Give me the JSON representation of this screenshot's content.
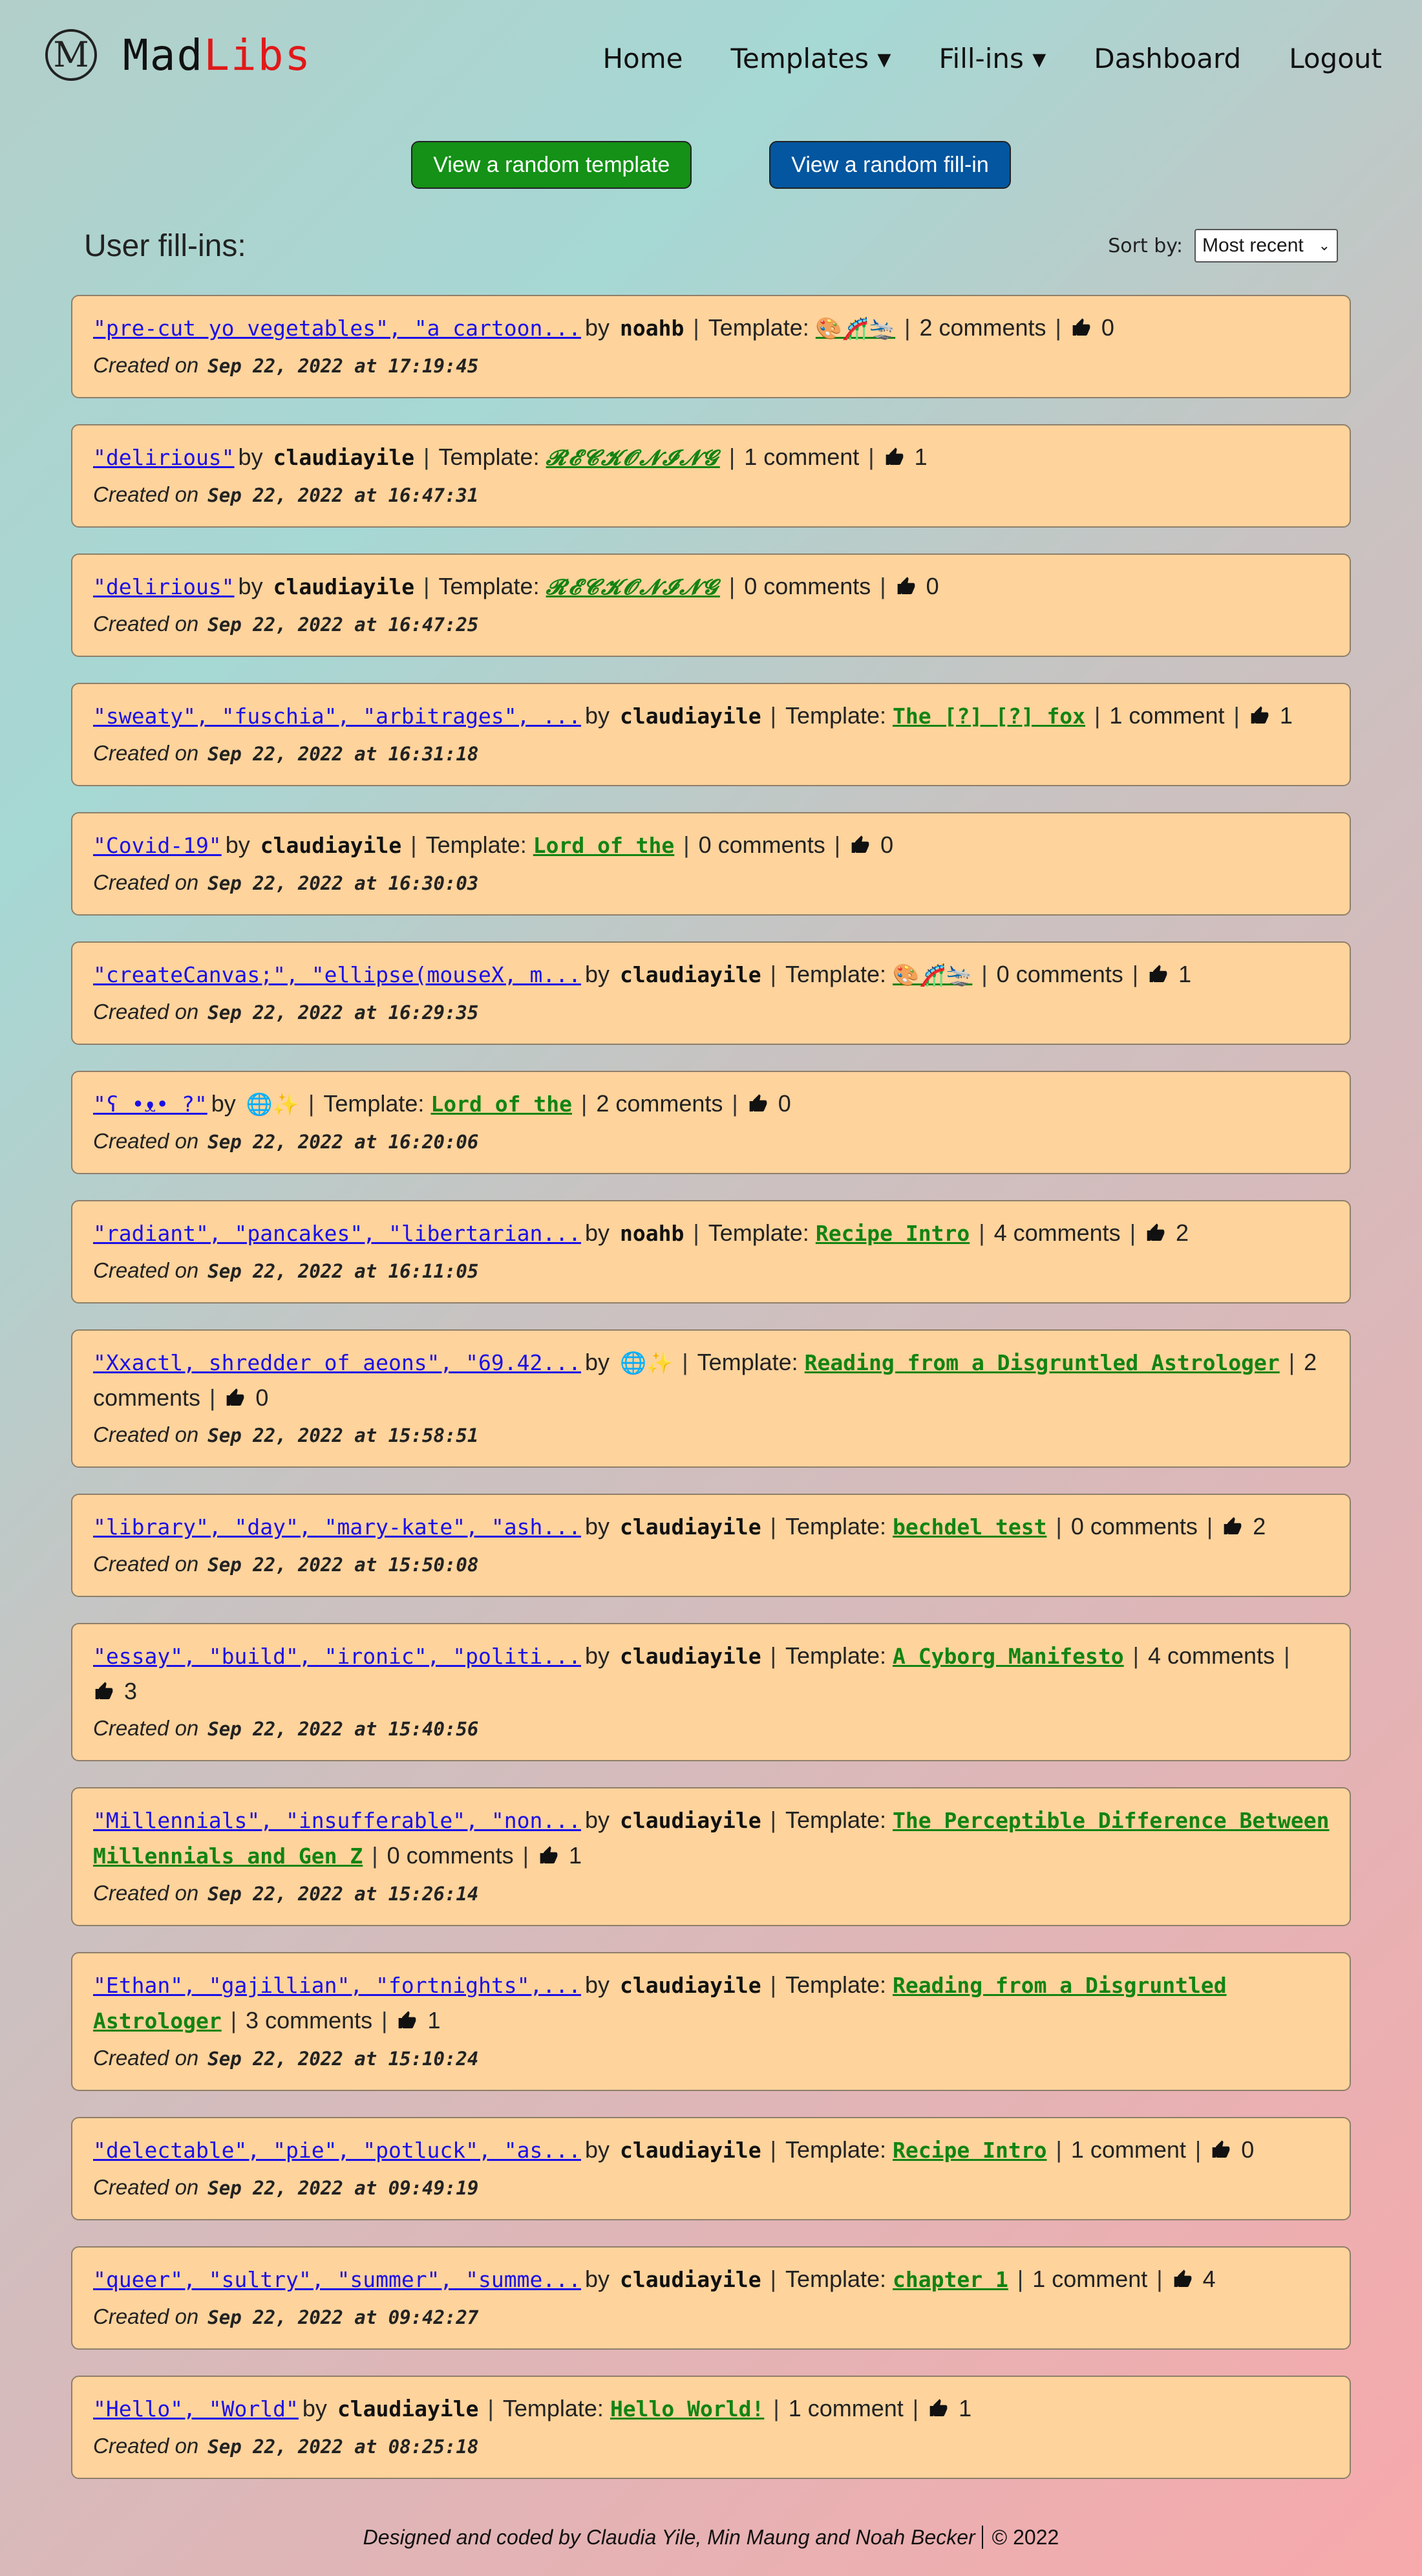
{
  "header": {
    "logo_letter": "M",
    "logo_mad": "Mad",
    "logo_libs": "Libs",
    "nav": [
      "Home",
      "Templates ▾",
      "Fill-ins ▾",
      "Dashboard",
      "Logout"
    ]
  },
  "buttons": {
    "random_template": "View a random template",
    "random_fillin": "View a random fill-in"
  },
  "page": {
    "title": "User fill-ins:",
    "sort_label": "Sort by:",
    "sort_value": "Most recent"
  },
  "labels": {
    "by": "by",
    "template": "Template:",
    "created_on": "Created on"
  },
  "fillins": [
    {
      "text": "\"pre-cut yo vegetables\", \"a cartoon...",
      "author": "noahb",
      "template": "🎨🎢🛬",
      "fancy": false,
      "comments": "2 comments",
      "likes": "0",
      "created": "Sep 22, 2022 at 17:19:45"
    },
    {
      "text": "\"delirious\"",
      "author": "claudiayile",
      "template": "𝓡𝓔𝓒𝓚𝓞𝓝𝓘𝓝𝓖",
      "fancy": true,
      "comments": "1 comment",
      "likes": "1",
      "created": "Sep 22, 2022 at 16:47:31"
    },
    {
      "text": "\"delirious\"",
      "author": "claudiayile",
      "template": "𝓡𝓔𝓒𝓚𝓞𝓝𝓘𝓝𝓖",
      "fancy": true,
      "comments": "0 comments",
      "likes": "0",
      "created": "Sep 22, 2022 at 16:47:25"
    },
    {
      "text": "\"sweaty\", \"fuschia\", \"arbitrages\", ...",
      "author": "claudiayile",
      "template": "The [?] [?] fox",
      "fancy": false,
      "comments": "1 comment",
      "likes": "1",
      "created": "Sep 22, 2022 at 16:31:18"
    },
    {
      "text": "\"Covid-19\"",
      "author": "claudiayile",
      "template": "Lord of the",
      "fancy": false,
      "comments": "0 comments",
      "likes": "0",
      "created": "Sep 22, 2022 at 16:30:03"
    },
    {
      "text": "\"createCanvas;\", \"ellipse(mouseX, m...",
      "author": "claudiayile",
      "template": "🎨🎢🛬",
      "fancy": false,
      "comments": "0 comments",
      "likes": "1",
      "created": "Sep 22, 2022 at 16:29:35"
    },
    {
      "text": "\"ʕ •ᴥ• ?\"",
      "author": "🌐✨",
      "template": "Lord of the",
      "fancy": false,
      "comments": "2 comments",
      "likes": "0",
      "created": "Sep 22, 2022 at 16:20:06"
    },
    {
      "text": "\"radiant\", \"pancakes\", \"libertarian...",
      "author": "noahb",
      "template": "Recipe Intro",
      "fancy": false,
      "comments": "4 comments",
      "likes": "2",
      "created": "Sep 22, 2022 at 16:11:05"
    },
    {
      "text": "\"Xxactl, shredder of aeons\", \"69.42...",
      "author": "🌐✨",
      "template": "Reading from a Disgruntled Astrologer",
      "fancy": false,
      "comments": "2 comments",
      "likes": "0",
      "created": "Sep 22, 2022 at 15:58:51"
    },
    {
      "text": "\"library\", \"day\", \"mary-kate\", \"ash...",
      "author": "claudiayile",
      "template": "bechdel test",
      "fancy": false,
      "comments": "0 comments",
      "likes": "2",
      "created": "Sep 22, 2022 at 15:50:08"
    },
    {
      "text": "\"essay\", \"build\", \"ironic\", \"politi...",
      "author": "claudiayile",
      "template": "A Cyborg Manifesto",
      "fancy": false,
      "comments": "4 comments",
      "likes": "3",
      "created": "Sep 22, 2022 at 15:40:56"
    },
    {
      "text": "\"Millennials\", \"insufferable\", \"non...",
      "author": "claudiayile",
      "template": "The Perceptible Difference Between Millennials and Gen Z",
      "fancy": false,
      "comments": "0 comments",
      "likes": "1",
      "created": "Sep 22, 2022 at 15:26:14"
    },
    {
      "text": "\"Ethan\", \"gajillian\", \"fortnights\",...",
      "author": "claudiayile",
      "template": "Reading from a Disgruntled Astrologer",
      "fancy": false,
      "comments": "3 comments",
      "likes": "1",
      "created": "Sep 22, 2022 at 15:10:24"
    },
    {
      "text": "\"delectable\", \"pie\", \"potluck\", \"as...",
      "author": "claudiayile",
      "template": "Recipe Intro",
      "fancy": false,
      "comments": "1 comment",
      "likes": "0",
      "created": "Sep 22, 2022 at 09:49:19"
    },
    {
      "text": "\"queer\", \"sultry\", \"summer\", \"summe...",
      "author": "claudiayile",
      "template": "chapter 1",
      "fancy": false,
      "comments": "1 comment",
      "likes": "4",
      "created": "Sep 22, 2022 at 09:42:27"
    },
    {
      "text": "\"Hello\", \"World\"",
      "author": "claudiayile",
      "template": "Hello World!",
      "fancy": false,
      "comments": "1 comment",
      "likes": "1",
      "created": "Sep 22, 2022 at 08:25:18"
    }
  ],
  "footer": {
    "credits": "Designed and coded by Claudia Yile, Min Maung and Noah Becker",
    "copyright": "© 2022"
  }
}
